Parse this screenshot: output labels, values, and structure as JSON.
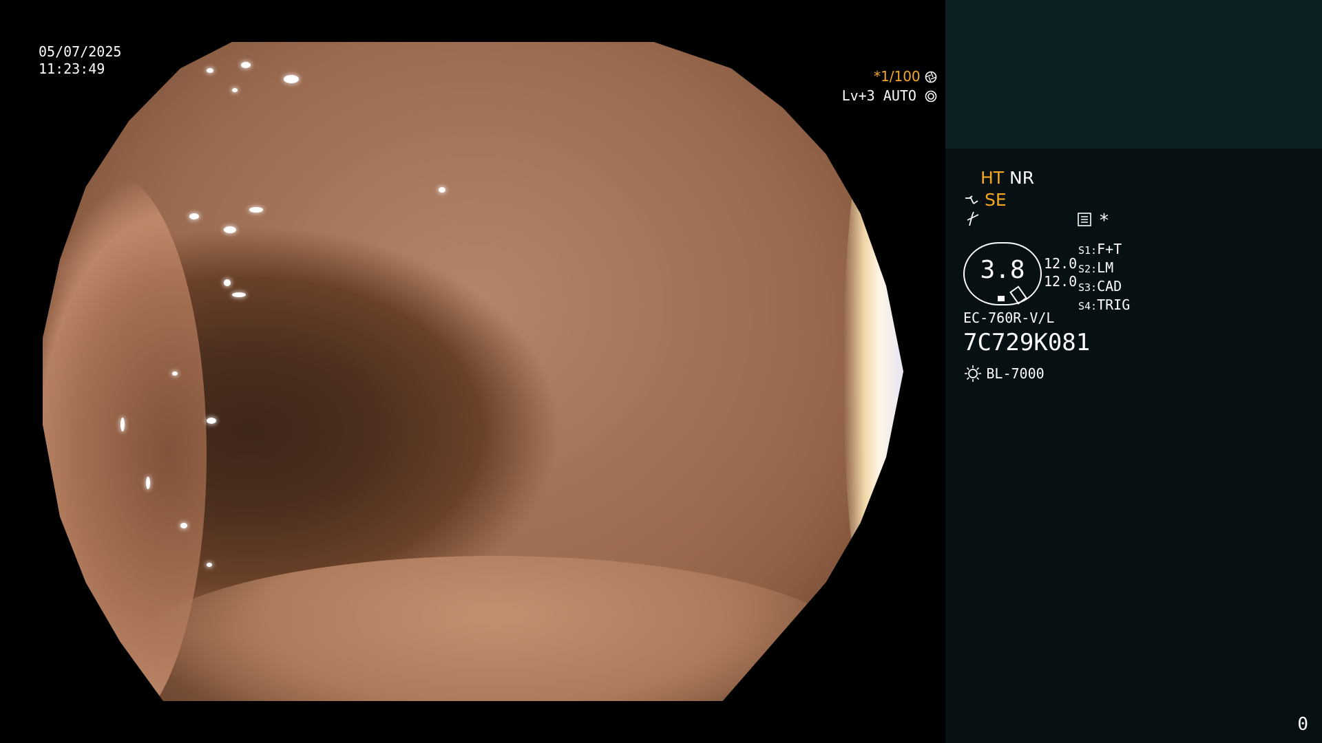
{
  "overlay": {
    "date": "05/07/2025",
    "time": "11:23:49",
    "shutter": "*1/100",
    "shutter_icon": "aperture-icon",
    "level": "Lv+3",
    "auto": "AUTO",
    "auto_icon": "iris-icon"
  },
  "panel": {
    "mode_ht": "HT",
    "mode_nr": "NR",
    "mode_se": "SE",
    "icons": [
      "scope-tip-icon",
      "curve-icon",
      "menu-icon"
    ],
    "asterisk": "*",
    "zoom_value": "3.8",
    "param_a": "12.0",
    "param_b": "12.0",
    "switches": [
      {
        "key": "S1:",
        "value": "F+T"
      },
      {
        "key": "S2:",
        "value": "LM"
      },
      {
        "key": "S3:",
        "value": "CAD"
      },
      {
        "key": "S4:",
        "value": "TRIG"
      }
    ],
    "scope_model": "EC-760R-V/L",
    "serial": "7C729K081",
    "light_icon": "light-source-icon",
    "light_source": "BL-7000",
    "frame_count": "0"
  },
  "colors": {
    "panel_bg": "#071113",
    "panel_top_bg": "#0c1f21",
    "accent_amber": "#f5a623"
  }
}
